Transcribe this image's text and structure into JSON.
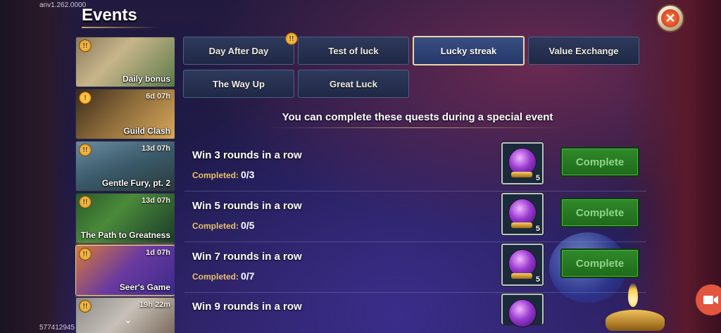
{
  "version": "anv1.262.0000",
  "build": "577412945",
  "title": "Events",
  "close_icon": "close-icon",
  "sidebar": {
    "items": [
      {
        "name": "Daily bonus",
        "timer": "",
        "badge": "!!"
      },
      {
        "name": "Guild Clash",
        "timer": "6d 07h",
        "badge": "!"
      },
      {
        "name": "Gentle Fury, pt. 2",
        "timer": "13d 07h",
        "badge": "!!"
      },
      {
        "name": "The Path to Greatness",
        "timer": "13d 07h",
        "badge": "!!"
      },
      {
        "name": "Seer's Game",
        "timer": "1d 07h",
        "badge": "!!"
      },
      {
        "name": "",
        "timer": "19h 22m",
        "badge": "!!"
      }
    ]
  },
  "tabs": [
    {
      "label": "Day After Day"
    },
    {
      "label": "Test of luck"
    },
    {
      "label": "Lucky streak"
    },
    {
      "label": "Value Exchange"
    },
    {
      "label": "The Way Up"
    },
    {
      "label": "Great Luck"
    }
  ],
  "active_tab": "Lucky streak",
  "subtitle": "You can complete these quests during a special event",
  "quests": [
    {
      "title": "Win 3 rounds in a row",
      "progress_label": "Completed:",
      "progress": "0/3",
      "reward_qty": "5",
      "button": "Complete"
    },
    {
      "title": "Win 5 rounds in a row",
      "progress_label": "Completed:",
      "progress": "0/5",
      "reward_qty": "5",
      "button": "Complete"
    },
    {
      "title": "Win 7 rounds in a row",
      "progress_label": "Completed:",
      "progress": "0/7",
      "reward_qty": "5",
      "button": "Complete"
    },
    {
      "title": "Win 9 rounds in a row",
      "progress_label": "",
      "progress": "",
      "reward_qty": "",
      "button": ""
    }
  ],
  "colors": {
    "accent_gold": "#e8c16a",
    "complete_green": "#2f8a2a",
    "tab_active_border": "#e8d7a8"
  }
}
